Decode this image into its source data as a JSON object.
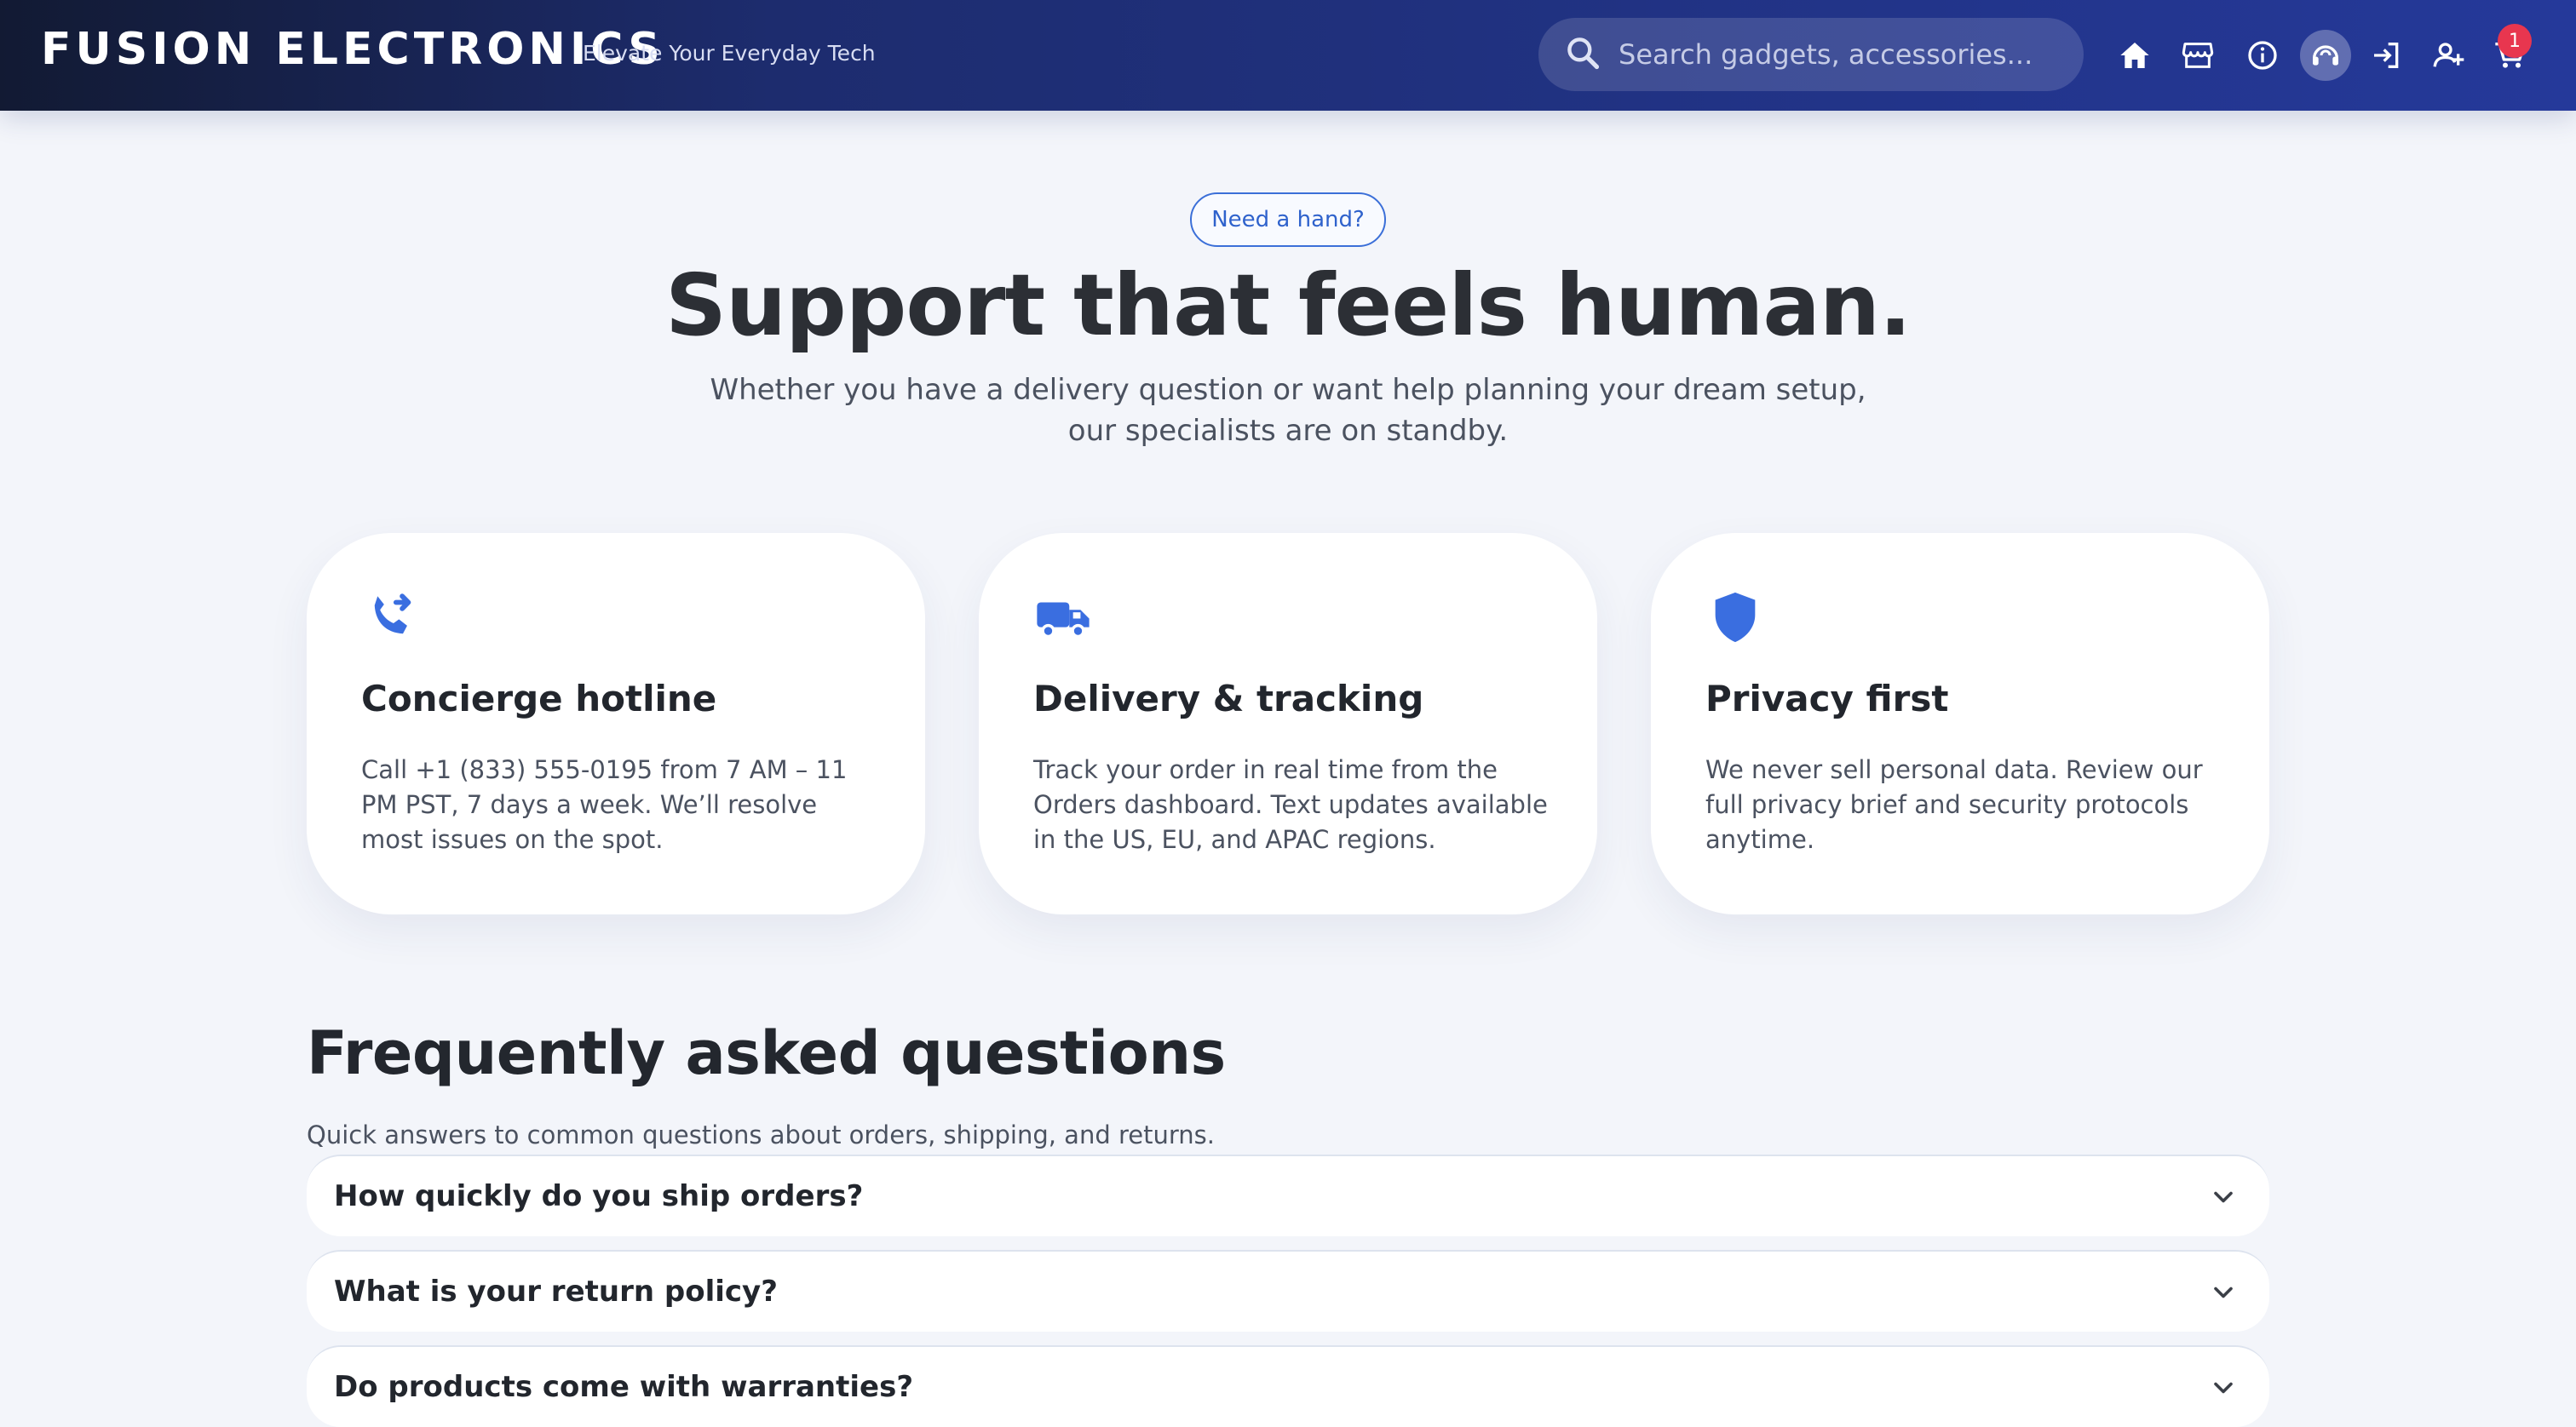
{
  "header": {
    "brand": "FUSION ELECTRONICS",
    "tagline": "Elevate Your Everyday Tech",
    "search_placeholder": "Search gadgets, accessories...",
    "nav_icons": [
      "home-icon",
      "store-icon",
      "info-icon",
      "support-icon",
      "login-icon",
      "register-icon",
      "cart-icon"
    ],
    "cart_count": "1",
    "colors": {
      "gradient_start": "#121a33",
      "gradient_end": "#25399a",
      "badge": "#e8364f"
    }
  },
  "hero": {
    "pill": "Need a hand?",
    "title": "Support that feels human.",
    "subtitle": "Whether you have a delivery question or want help planning your dream setup, our specialists are on standby."
  },
  "cards": [
    {
      "icon": "phone-forward-icon",
      "title": "Concierge hotline",
      "body": "Call +1 (833) 555-0195 from 7 AM – 11 PM PST, 7 days a week. We’ll resolve most issues on the spot."
    },
    {
      "icon": "truck-icon",
      "title": "Delivery & tracking",
      "body": "Track your order in real time from the Orders dashboard. Text updates available in the US, EU, and APAC regions."
    },
    {
      "icon": "shield-icon",
      "title": "Privacy first",
      "body": "We never sell personal data. Review our full privacy brief and security protocols anytime."
    }
  ],
  "faq": {
    "title": "Frequently asked questions",
    "subtitle": "Quick answers to common questions about orders, shipping, and returns.",
    "items": [
      {
        "question": "How quickly do you ship orders?"
      },
      {
        "question": "What is your return policy?"
      },
      {
        "question": "Do products come with warranties?"
      }
    ]
  },
  "accent_color": "#3a6ee0"
}
